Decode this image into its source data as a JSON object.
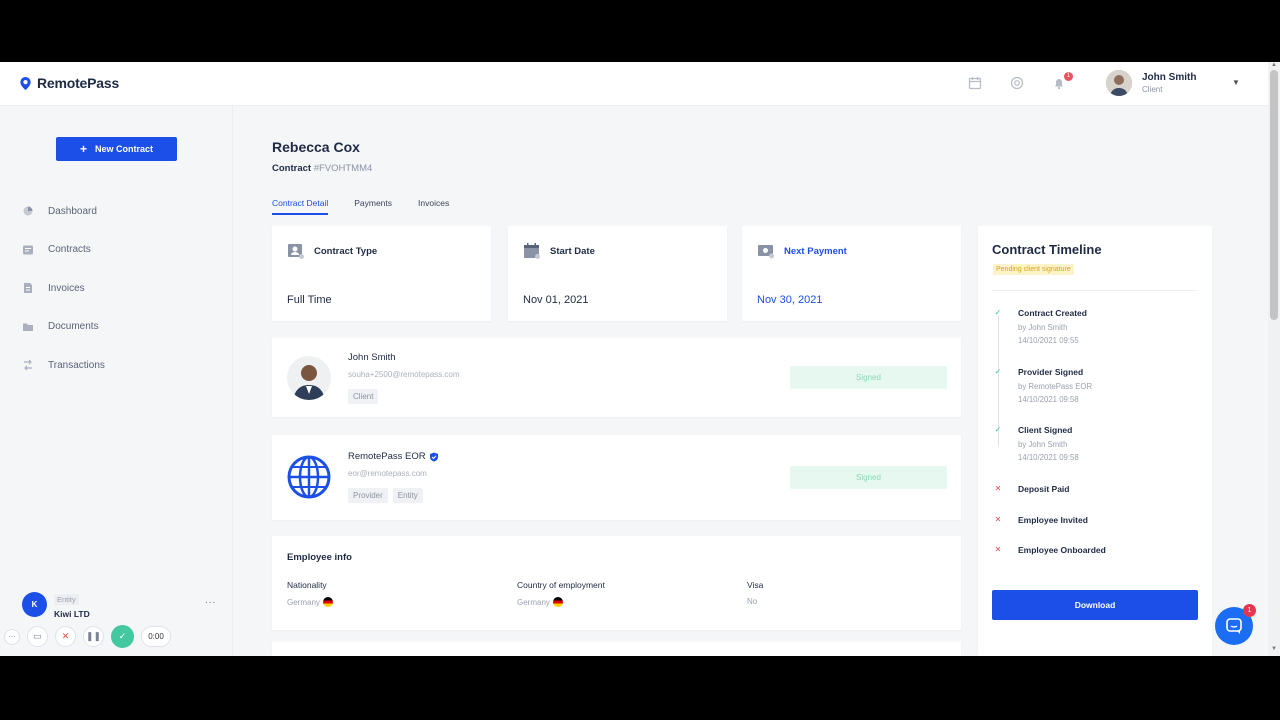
{
  "brand": {
    "name": "RemotePass"
  },
  "user": {
    "name": "John Smith",
    "role": "Client",
    "notifications": "1"
  },
  "sidebar": {
    "new_contract": "New Contract",
    "items": [
      {
        "label": "Dashboard",
        "icon": "pie-chart-icon"
      },
      {
        "label": "Contracts",
        "icon": "contract-icon"
      },
      {
        "label": "Invoices",
        "icon": "invoice-icon"
      },
      {
        "label": "Documents",
        "icon": "folder-icon"
      },
      {
        "label": "Transactions",
        "icon": "transactions-icon"
      }
    ],
    "entity": {
      "initial": "K",
      "label": "Entity",
      "name": "Kiwi LTD",
      "more": "..."
    }
  },
  "recorder": {
    "time": "0:00"
  },
  "page": {
    "title": "Rebecca Cox",
    "contract_label": "Contract",
    "contract_id": "#FVOHTMM4",
    "tabs": [
      "Contract Detail",
      "Payments",
      "Invoices"
    ]
  },
  "info_cards": [
    {
      "label": "Contract Type",
      "value": "Full Time"
    },
    {
      "label": "Start Date",
      "value": "Nov 01, 2021"
    },
    {
      "label": "Next Payment",
      "value": "Nov 30, 2021"
    }
  ],
  "parties": [
    {
      "name": "John Smith",
      "email": "souha+2500@remotepass.com",
      "tags": [
        "Client"
      ],
      "status": "Signed"
    },
    {
      "name": "RemotePass EOR",
      "email": "eor@remotepass.com",
      "tags": [
        "Provider",
        "Entity"
      ],
      "status": "Signed"
    }
  ],
  "employee_info": {
    "title": "Employee info",
    "fields": [
      {
        "label": "Nationality",
        "value": "Germany"
      },
      {
        "label": "Country of employment",
        "value": "Germany"
      },
      {
        "label": "Visa",
        "value": "No"
      }
    ]
  },
  "timeline": {
    "title": "Contract Timeline",
    "badge": "Pending client signature",
    "items": [
      {
        "name": "Contract Created",
        "by": "by John Smith",
        "date": "14/10/2021 09:55",
        "done": true
      },
      {
        "name": "Provider Signed",
        "by": "by RemotePass EOR",
        "date": "14/10/2021 09:58",
        "done": true
      },
      {
        "name": "Client Signed",
        "by": "by John Smith",
        "date": "14/10/2021 09:58",
        "done": true
      },
      {
        "name": "Deposit Paid",
        "done": false
      },
      {
        "name": "Employee Invited",
        "done": false
      },
      {
        "name": "Employee Onboarded",
        "done": false
      }
    ],
    "download": "Download"
  },
  "chat": {
    "badge": "1"
  },
  "colors": {
    "primary": "#1b4fe8",
    "signed_bg": "#e6f8f0",
    "success": "#2ec4a0",
    "danger": "#e24b4b"
  }
}
